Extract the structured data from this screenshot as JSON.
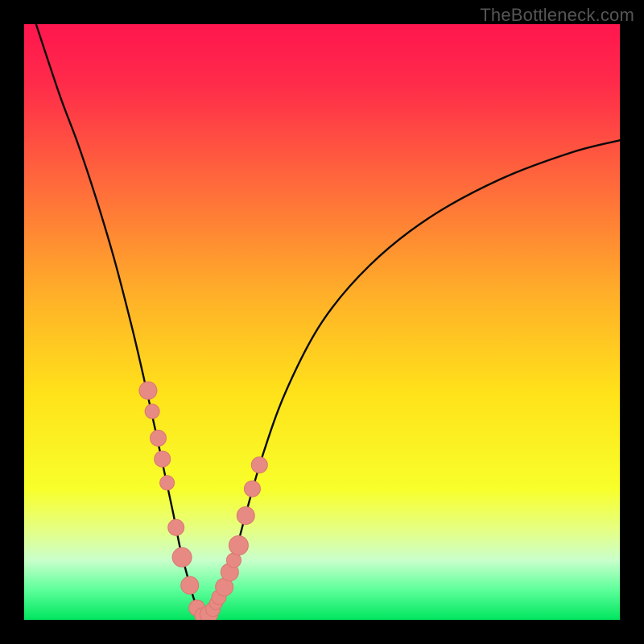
{
  "watermark": "TheBottleneck.com",
  "colors": {
    "frame": "#000000",
    "gradient_stops": [
      {
        "offset": 0.0,
        "color": "#ff164e"
      },
      {
        "offset": 0.1,
        "color": "#ff2b4a"
      },
      {
        "offset": 0.28,
        "color": "#ff6e3a"
      },
      {
        "offset": 0.45,
        "color": "#ffae29"
      },
      {
        "offset": 0.62,
        "color": "#ffe21a"
      },
      {
        "offset": 0.78,
        "color": "#f8ff2a"
      },
      {
        "offset": 0.85,
        "color": "#e5ff86"
      },
      {
        "offset": 0.9,
        "color": "#c9ffcb"
      },
      {
        "offset": 0.95,
        "color": "#5cff9a"
      },
      {
        "offset": 1.0,
        "color": "#00e55f"
      }
    ],
    "curve": "#0a0a0a",
    "marker_fill": "#e88a84",
    "marker_stroke": "#d87770"
  },
  "chart_data": {
    "type": "line",
    "title": "",
    "xlabel": "",
    "ylabel": "",
    "xlim": [
      0,
      1
    ],
    "ylim": [
      0,
      100
    ],
    "series": [
      {
        "name": "bottleneck-curve",
        "x": [
          0.02,
          0.06,
          0.09,
          0.12,
          0.15,
          0.18,
          0.2,
          0.22,
          0.235,
          0.25,
          0.262,
          0.275,
          0.285,
          0.295,
          0.305,
          0.315,
          0.33,
          0.35,
          0.37,
          0.4,
          0.44,
          0.5,
          0.58,
          0.68,
          0.8,
          0.92,
          1.0
        ],
        "y": [
          100.0,
          88.0,
          80.0,
          71.0,
          61.0,
          49.5,
          41.0,
          32.0,
          25.0,
          18.0,
          12.0,
          7.0,
          3.5,
          1.2,
          0.5,
          1.4,
          4.0,
          9.5,
          17.0,
          27.5,
          38.5,
          50.0,
          59.5,
          67.5,
          74.0,
          78.5,
          80.5
        ]
      }
    ],
    "markers": {
      "name": "highlighted-points",
      "x": [
        0.208,
        0.215,
        0.225,
        0.232,
        0.24,
        0.255,
        0.265,
        0.278,
        0.29,
        0.3,
        0.31,
        0.317,
        0.322,
        0.327,
        0.336,
        0.345,
        0.352,
        0.36,
        0.372,
        0.383,
        0.395
      ],
      "y": [
        38.5,
        35.0,
        30.5,
        27.0,
        23.0,
        15.5,
        10.5,
        5.8,
        2.0,
        0.7,
        0.9,
        1.8,
        2.8,
        3.8,
        5.5,
        8.0,
        10.0,
        12.5,
        17.5,
        22.0,
        26.0
      ],
      "r": [
        11,
        9,
        10,
        10,
        9,
        10,
        12,
        11,
        10,
        10,
        11,
        9,
        8,
        9,
        11,
        11,
        9,
        12,
        11,
        10,
        10
      ]
    }
  }
}
